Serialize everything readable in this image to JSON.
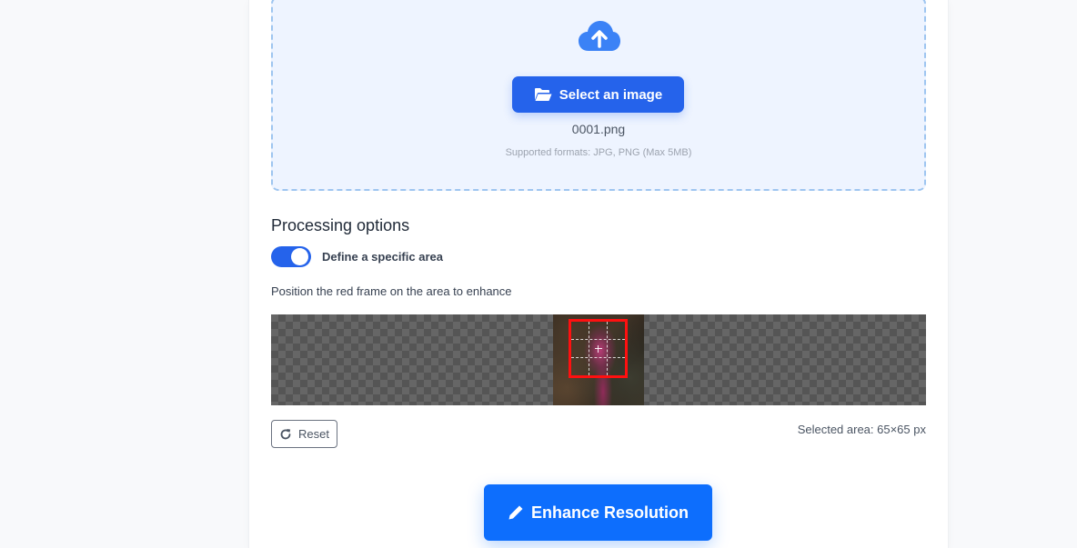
{
  "upload": {
    "button_label": "Select an image",
    "file_name": "0001.png",
    "formats_note": "Supported formats: JPG, PNG (Max 5MB)"
  },
  "options": {
    "title": "Processing options",
    "toggle_label": "Define a specific area",
    "toggle_on": true,
    "instruction": "Position the red frame on the area to enhance"
  },
  "crop": {
    "reset_label": "Reset",
    "selected_area": "Selected area: 65×65 px"
  },
  "actions": {
    "enhance_label": "Enhance Resolution"
  },
  "colors": {
    "primary": "#2563eb",
    "enhance": "#0d6efd",
    "frame": "#ff1010",
    "dropzone_bg": "#eef4ff"
  },
  "icons": {
    "upload": "cloud-upload-icon",
    "folder": "folder-open-icon",
    "reset": "redo-icon",
    "enhance": "pencil-icon"
  }
}
